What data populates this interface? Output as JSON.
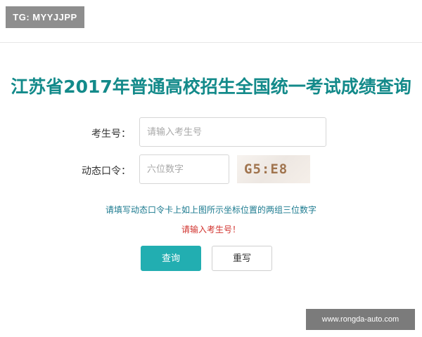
{
  "badge": {
    "text": "TG: MYYJJPP"
  },
  "page": {
    "title": "江苏省2017年普通高校招生全国统一考试成绩查询"
  },
  "form": {
    "exam_number": {
      "label": "考生号：",
      "placeholder": "请输入考生号",
      "value": ""
    },
    "dynamic_code": {
      "label": "动态口令：",
      "placeholder": "六位数字",
      "value": ""
    },
    "captcha": {
      "text": "G5:E8"
    },
    "hint": "请填写动态口令卡上如上图所示坐标位置的两组三位数字",
    "error": "请输入考生号！",
    "query_label": "查询",
    "reset_label": "重写"
  },
  "watermark": {
    "text": "www.rongda-auto.com"
  },
  "colors": {
    "title": "#138a8a",
    "hint": "#1b7a8f",
    "error": "#d1332e",
    "primary_button": "#22aeb1"
  }
}
